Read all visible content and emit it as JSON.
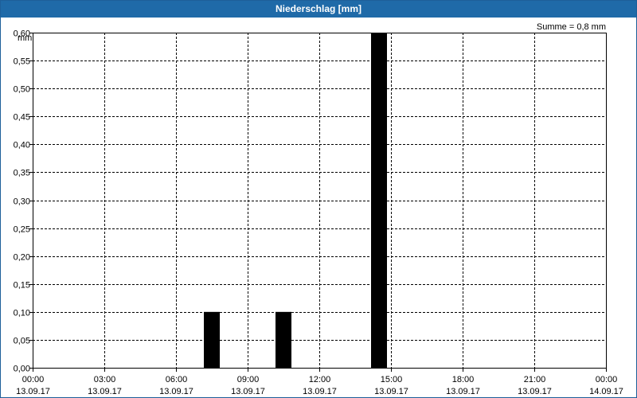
{
  "window": {
    "title": "Niederschlag [mm]"
  },
  "chart_data": {
    "type": "bar",
    "title": "Niederschlag [mm]",
    "ylabel": "mm",
    "xlabel": "",
    "annotation": "Summe = 0,8 mm",
    "ylim": [
      0,
      0.6
    ],
    "xlim": [
      "13.09.17 00:00",
      "14.09.17 00:00"
    ],
    "y_ticks": [
      "0,00",
      "0,05",
      "0,10",
      "0,15",
      "0,20",
      "0,25",
      "0,30",
      "0,35",
      "0,40",
      "0,45",
      "0,50",
      "0,55",
      "0,60"
    ],
    "x_ticks": [
      {
        "time": "00:00",
        "date": "13.09.17"
      },
      {
        "time": "03:00",
        "date": "13.09.17"
      },
      {
        "time": "06:00",
        "date": "13.09.17"
      },
      {
        "time": "09:00",
        "date": "13.09.17"
      },
      {
        "time": "12:00",
        "date": "13.09.17"
      },
      {
        "time": "15:00",
        "date": "13.09.17"
      },
      {
        "time": "18:00",
        "date": "13.09.17"
      },
      {
        "time": "21:00",
        "date": "13.09.17"
      },
      {
        "time": "00:00",
        "date": "14.09.17"
      }
    ],
    "bars": [
      {
        "time": "13.09.17 07:30",
        "value": 0.1
      },
      {
        "time": "13.09.17 10:30",
        "value": 0.1
      },
      {
        "time": "13.09.17 14:30",
        "value": 0.6
      }
    ],
    "grid": true,
    "bar_color": "#000000"
  }
}
